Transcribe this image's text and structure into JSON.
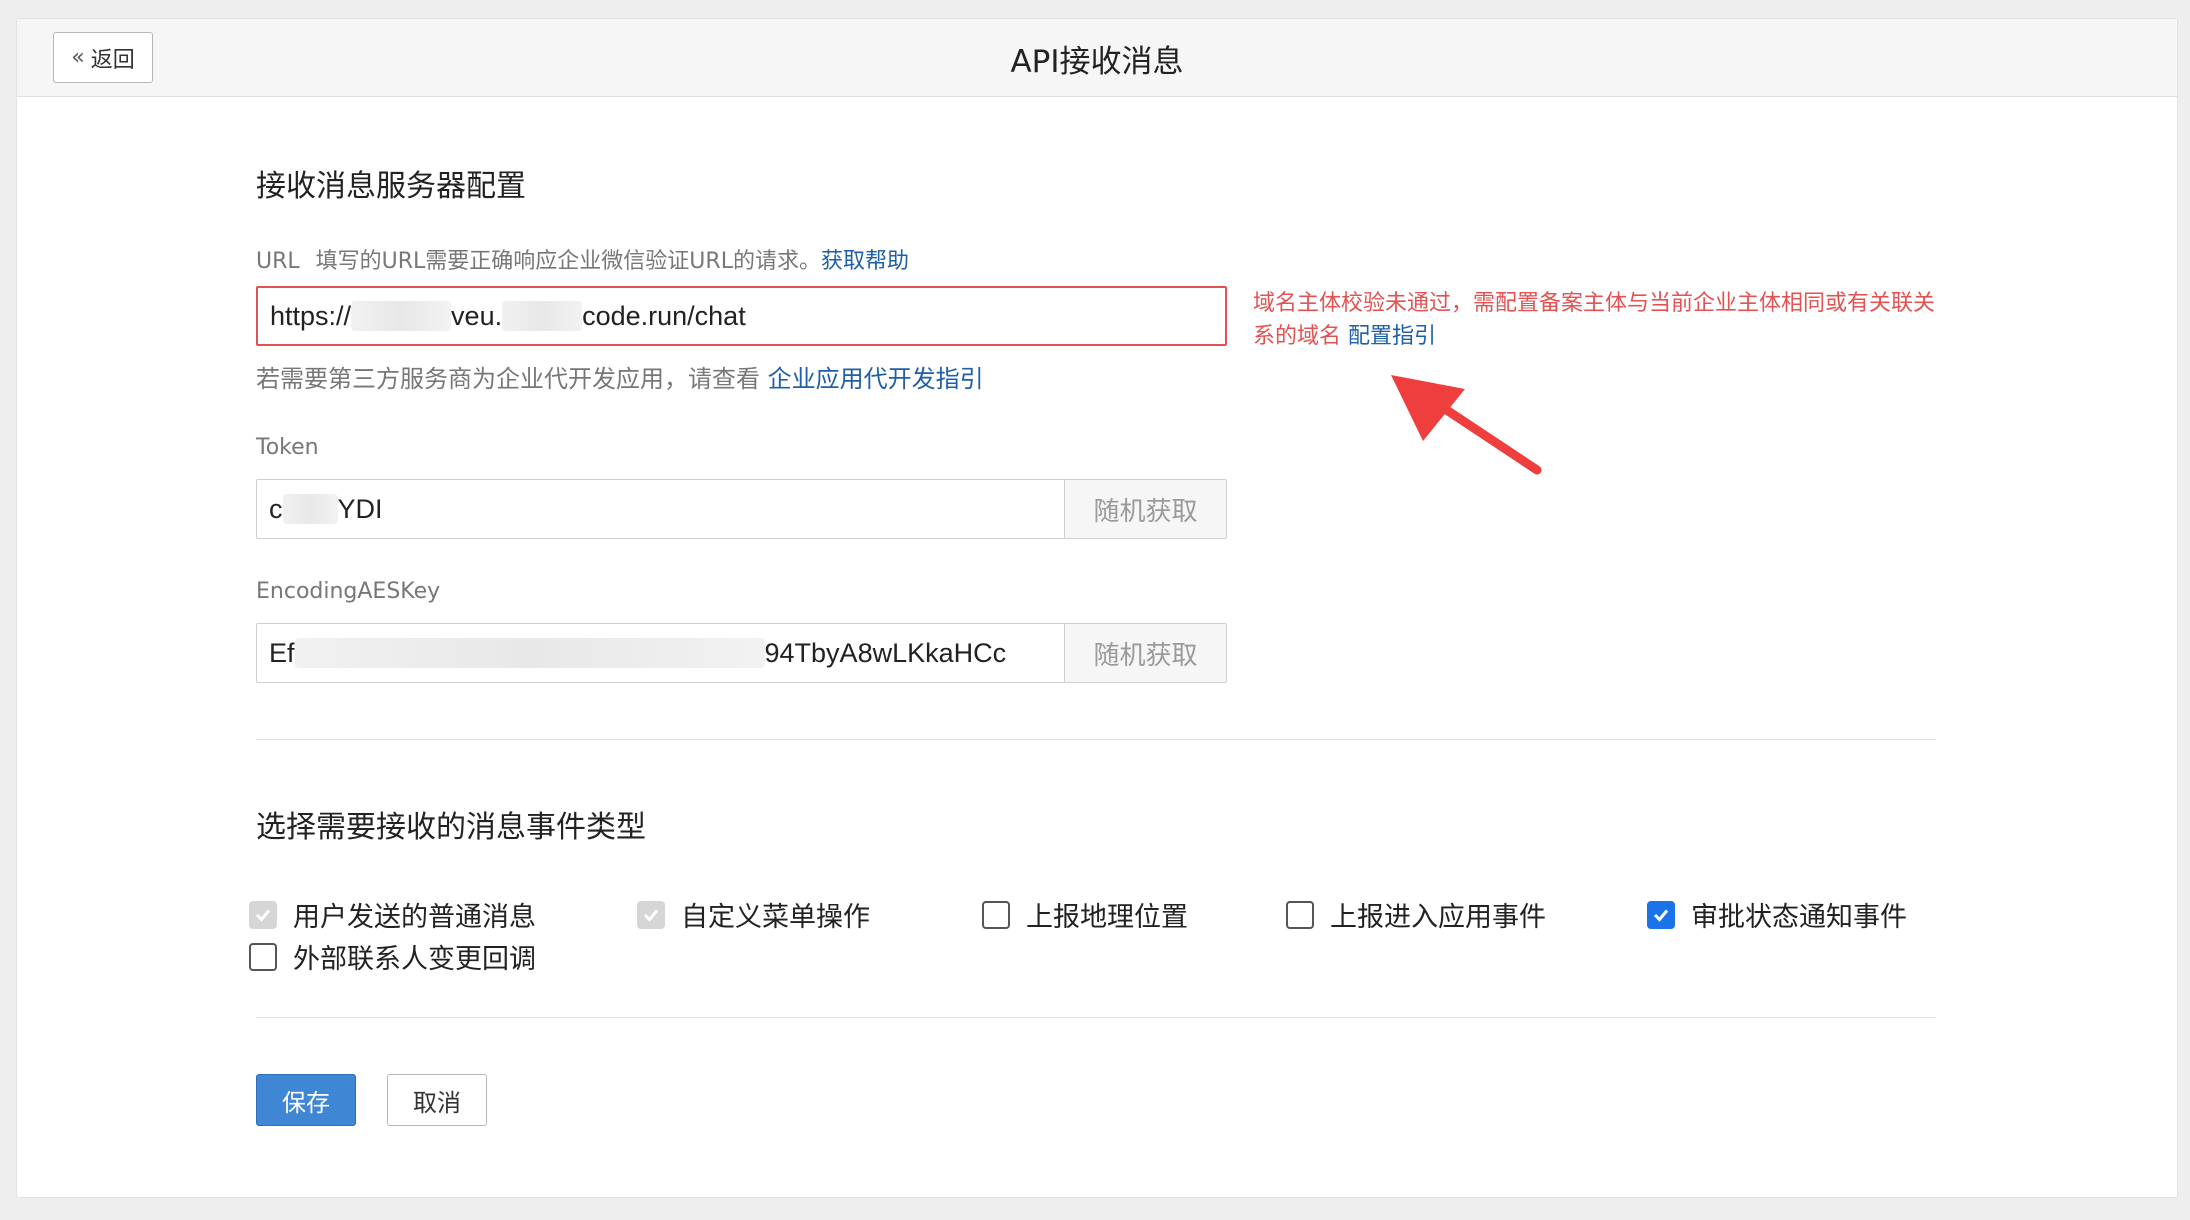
{
  "header": {
    "back_label": "返回",
    "title": "API接收消息"
  },
  "server_config": {
    "title": "接收消息服务器配置",
    "url": {
      "label": "URL",
      "help_text": "填写的URL需要正确响应企业微信验证URL的请求。",
      "help_link": "获取帮助",
      "value_prefix": "https://",
      "value_middle": "veu.",
      "value_suffix": "code.run/chat",
      "hint_text": "若需要第三方服务商为企业代开发应用，请查看",
      "hint_link": "企业应用代开发指引",
      "error_text": "域名主体校验未通过，需配置备案主体与当前企业主体相同或有关联关系的域名",
      "error_link": "配置指引"
    },
    "token": {
      "label": "Token",
      "value_prefix": "c",
      "value_suffix": "YDI",
      "button_label": "随机获取"
    },
    "aes_key": {
      "label": "EncodingAESKey",
      "value_prefix": "Ef",
      "value_suffix": "94TbyA8wLKkaHCc",
      "button_label": "随机获取"
    }
  },
  "events": {
    "title": "选择需要接收的消息事件类型",
    "options": [
      {
        "label": "用户发送的普通消息",
        "state": "checked-disabled"
      },
      {
        "label": "自定义菜单操作",
        "state": "checked-disabled"
      },
      {
        "label": "上报地理位置",
        "state": "unchecked"
      },
      {
        "label": "上报进入应用事件",
        "state": "unchecked"
      },
      {
        "label": "审批状态通知事件",
        "state": "checked"
      },
      {
        "label": "外部联系人变更回调",
        "state": "unchecked"
      }
    ]
  },
  "actions": {
    "save_label": "保存",
    "cancel_label": "取消"
  },
  "colors": {
    "primary": "#3f86d4",
    "error": "#e35252",
    "link": "#1f5fa8",
    "checkbox_checked": "#1a73e8"
  }
}
